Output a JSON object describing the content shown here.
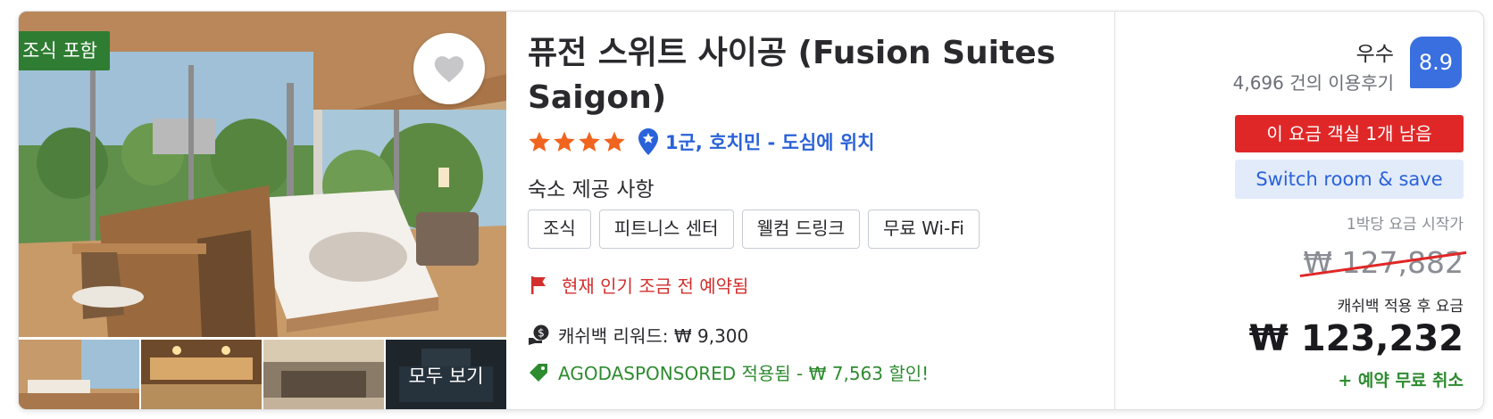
{
  "badges": {
    "breakfast": "조식 포함"
  },
  "gallery": {
    "more_label": "모두 보기"
  },
  "hotel": {
    "name": "퓨전 스위트 사이공 (Fusion Suites Saigon)",
    "star_count": 4,
    "location": "1군, 호치민 - 도심에 위치"
  },
  "amenities": {
    "title": "숙소 제공 사항",
    "items": [
      "조식",
      "피트니스 센터",
      "웰컴 드링크",
      "무료 Wi-Fi"
    ]
  },
  "urgency": {
    "text": "현재 인기 조금 전 예약됨"
  },
  "cashback": {
    "text": "캐쉬백 리워드: ₩ 9,300"
  },
  "coupon": {
    "text": "AGODASPONSORED 적용됨 - ₩ 7,563 할인!"
  },
  "review": {
    "word": "우수",
    "count": "4,696 건의 이용후기",
    "score": "8.9"
  },
  "pricing": {
    "scarcity": "이 요금 객실 1개 남음",
    "switch_label": "Switch room & save",
    "from_label": "1박당 요금 시작가",
    "original_price": "₩ 127,882",
    "after_label": "캐쉬백 적용 후 요금",
    "final_price": "₩ 123,232",
    "free_cancel": "+ 예약 무료 취소"
  },
  "colors": {
    "accent_blue": "#2a62d9",
    "badge_green": "#2e7d32",
    "alert_red": "#e02727",
    "star_orange": "#f0641e",
    "success_green": "#2e8b30"
  },
  "icons": {
    "favorite": "heart-icon",
    "location": "map-pin-icon",
    "urgency": "flag-icon",
    "cashback": "cashback-icon",
    "coupon": "tag-icon"
  }
}
